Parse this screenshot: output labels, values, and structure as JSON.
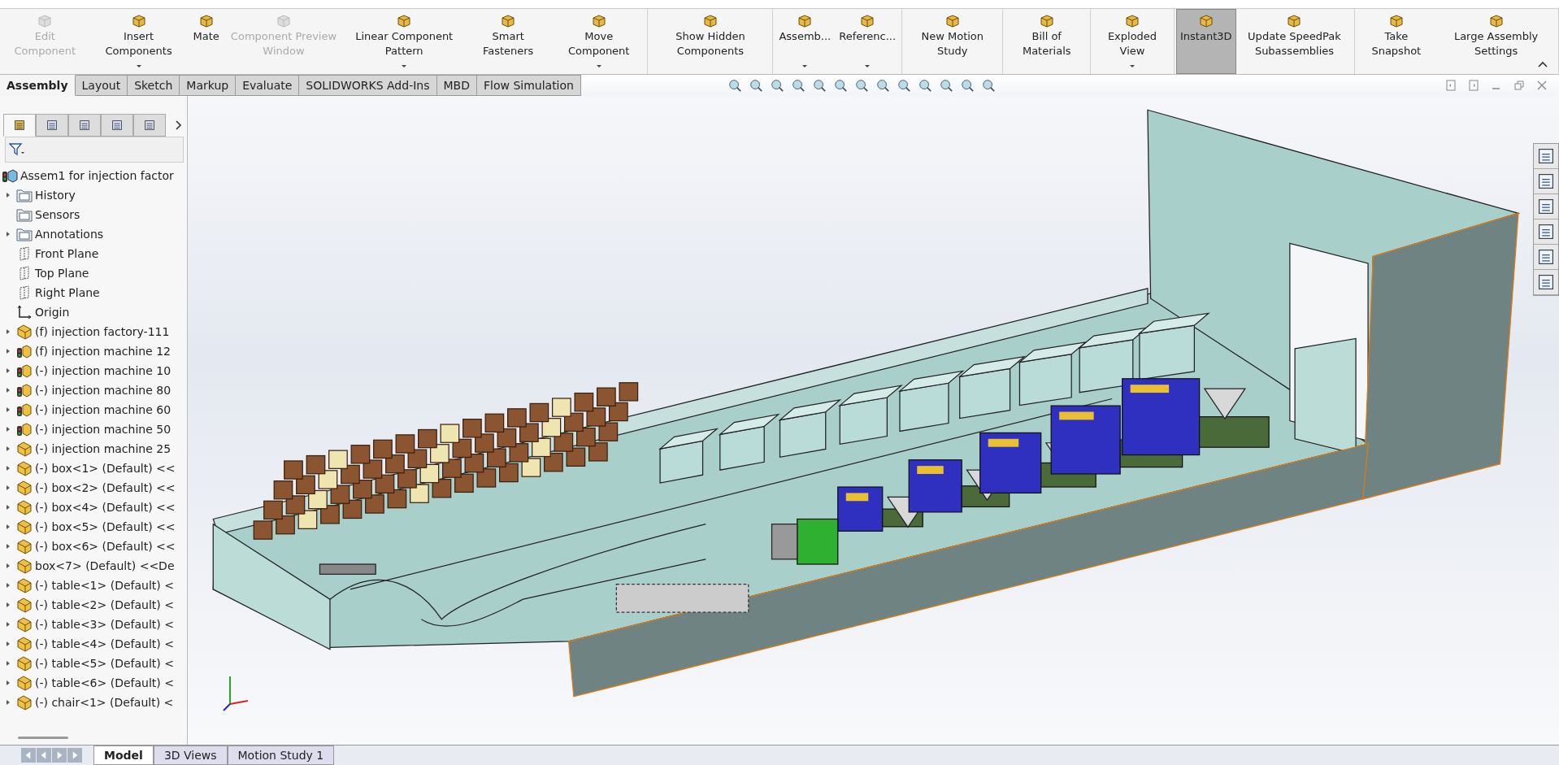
{
  "ribbon": {
    "command_groups": [
      {
        "commands": [
          {
            "label": "Edit Component",
            "disabled": true,
            "dropdown": false,
            "selected": false
          },
          {
            "label": "Insert Components",
            "disabled": false,
            "dropdown": true,
            "selected": false
          },
          {
            "label": "Mate",
            "disabled": false,
            "dropdown": false,
            "selected": false
          },
          {
            "label": "Component Preview Window",
            "disabled": true,
            "dropdown": false,
            "selected": false
          },
          {
            "label": "Linear Component Pattern",
            "disabled": false,
            "dropdown": true,
            "selected": false
          },
          {
            "label": "Smart Fasteners",
            "disabled": false,
            "dropdown": false,
            "selected": false
          },
          {
            "label": "Move Component",
            "disabled": false,
            "dropdown": true,
            "selected": false
          }
        ]
      },
      {
        "commands": [
          {
            "label": "Show Hidden Components",
            "disabled": false,
            "dropdown": false,
            "selected": false
          }
        ]
      },
      {
        "commands": [
          {
            "label": "Assemb...",
            "disabled": false,
            "dropdown": true,
            "selected": false
          },
          {
            "label": "Referenc...",
            "disabled": false,
            "dropdown": true,
            "selected": false
          }
        ]
      },
      {
        "commands": [
          {
            "label": "New Motion Study",
            "disabled": false,
            "dropdown": false,
            "selected": false
          }
        ]
      },
      {
        "commands": [
          {
            "label": "Bill of Materials",
            "disabled": false,
            "dropdown": false,
            "selected": false
          }
        ]
      },
      {
        "commands": [
          {
            "label": "Exploded View",
            "disabled": false,
            "dropdown": true,
            "selected": false
          }
        ]
      },
      {
        "commands": [
          {
            "label": "Instant3D",
            "disabled": false,
            "dropdown": false,
            "selected": true
          },
          {
            "label": "Update SpeedPak Subassemblies",
            "disabled": false,
            "dropdown": false,
            "selected": false
          }
        ]
      },
      {
        "commands": [
          {
            "label": "Take Snapshot",
            "disabled": false,
            "dropdown": false,
            "selected": false
          },
          {
            "label": "Large Assembly Settings",
            "disabled": false,
            "dropdown": false,
            "selected": false
          }
        ]
      }
    ]
  },
  "tabs": [
    {
      "label": "Assembly",
      "selected": true
    },
    {
      "label": "Layout",
      "selected": false
    },
    {
      "label": "Sketch",
      "selected": false
    },
    {
      "label": "Markup",
      "selected": false
    },
    {
      "label": "Evaluate",
      "selected": false
    },
    {
      "label": "SOLIDWORKS Add-Ins",
      "selected": false
    },
    {
      "label": "MBD",
      "selected": false
    },
    {
      "label": "Flow Simulation",
      "selected": false
    }
  ],
  "panel_tabs": [
    {
      "selected": true
    },
    {
      "selected": false
    },
    {
      "selected": false
    },
    {
      "selected": false
    },
    {
      "selected": false
    }
  ],
  "tree": {
    "root": {
      "label": "Assem1 for injection factor",
      "kind": "assembly"
    },
    "items": [
      {
        "label": "History",
        "kind": "folder",
        "expandable": true
      },
      {
        "label": "Sensors",
        "kind": "folder",
        "expandable": false
      },
      {
        "label": "Annotations",
        "kind": "folder",
        "expandable": true
      },
      {
        "label": "Front Plane",
        "kind": "plane",
        "expandable": false
      },
      {
        "label": "Top Plane",
        "kind": "plane",
        "expandable": false
      },
      {
        "label": "Right Plane",
        "kind": "plane",
        "expandable": false
      },
      {
        "label": "Origin",
        "kind": "origin",
        "expandable": false
      },
      {
        "label": "(f) injection factory-111",
        "kind": "part",
        "expandable": true
      },
      {
        "label": "(f) injection machine 12",
        "kind": "subassembly",
        "expandable": true
      },
      {
        "label": "(-) injection machine 10",
        "kind": "subassembly",
        "expandable": true
      },
      {
        "label": "(-) injection machine 80",
        "kind": "subassembly",
        "expandable": true
      },
      {
        "label": "(-) injection machine 60",
        "kind": "subassembly",
        "expandable": true
      },
      {
        "label": "(-) injection machine 50",
        "kind": "subassembly",
        "expandable": true
      },
      {
        "label": "(-) injection machine 25",
        "kind": "part",
        "expandable": true
      },
      {
        "label": "(-) box<1> (Default) <<",
        "kind": "part",
        "expandable": true
      },
      {
        "label": "(-) box<2> (Default) <<",
        "kind": "part",
        "expandable": true
      },
      {
        "label": "(-) box<4> (Default) <<",
        "kind": "part",
        "expandable": true
      },
      {
        "label": "(-) box<5> (Default) <<",
        "kind": "part",
        "expandable": true
      },
      {
        "label": "(-) box<6> (Default) <<",
        "kind": "part",
        "expandable": true
      },
      {
        "label": "box<7> (Default) <<De",
        "kind": "part",
        "expandable": true
      },
      {
        "label": "(-) table<1> (Default) <",
        "kind": "part",
        "expandable": true
      },
      {
        "label": "(-) table<2> (Default) <",
        "kind": "part",
        "expandable": true
      },
      {
        "label": "(-) table<3> (Default) <",
        "kind": "part",
        "expandable": true
      },
      {
        "label": "(-) table<4> (Default) <",
        "kind": "part",
        "expandable": true
      },
      {
        "label": "(-) table<5> (Default) <",
        "kind": "part",
        "expandable": true
      },
      {
        "label": "(-) table<6> (Default) <",
        "kind": "part",
        "expandable": true
      },
      {
        "label": "(-) chair<1> (Default) <",
        "kind": "part",
        "expandable": true
      }
    ]
  },
  "bottom_tabs": [
    {
      "label": "Model",
      "selected": true
    },
    {
      "label": "3D Views",
      "selected": false
    },
    {
      "label": "Motion Study 1",
      "selected": false
    }
  ]
}
